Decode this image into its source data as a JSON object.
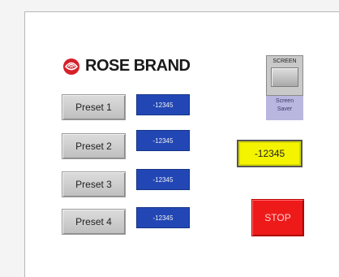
{
  "logo": {
    "icon": "rose-icon",
    "text": "ROSE BRAND"
  },
  "presets": [
    {
      "label": "Preset 1",
      "value": "-12345"
    },
    {
      "label": "Preset 2",
      "value": "-12345"
    },
    {
      "label": "Preset 3",
      "value": "-12345"
    },
    {
      "label": "Preset 4",
      "value": "-12345"
    }
  ],
  "screen_saver": {
    "header": "SCREEN",
    "caption": "Screen Saver"
  },
  "display": {
    "value": "-12345"
  },
  "stop": {
    "label": "STOP"
  },
  "colors": {
    "value_box": "#2247b5",
    "display": "#f4f400",
    "stop": "#ee1a1a",
    "screen_saver_panel": "#b9b6df",
    "logo_red": "#d5202a"
  }
}
